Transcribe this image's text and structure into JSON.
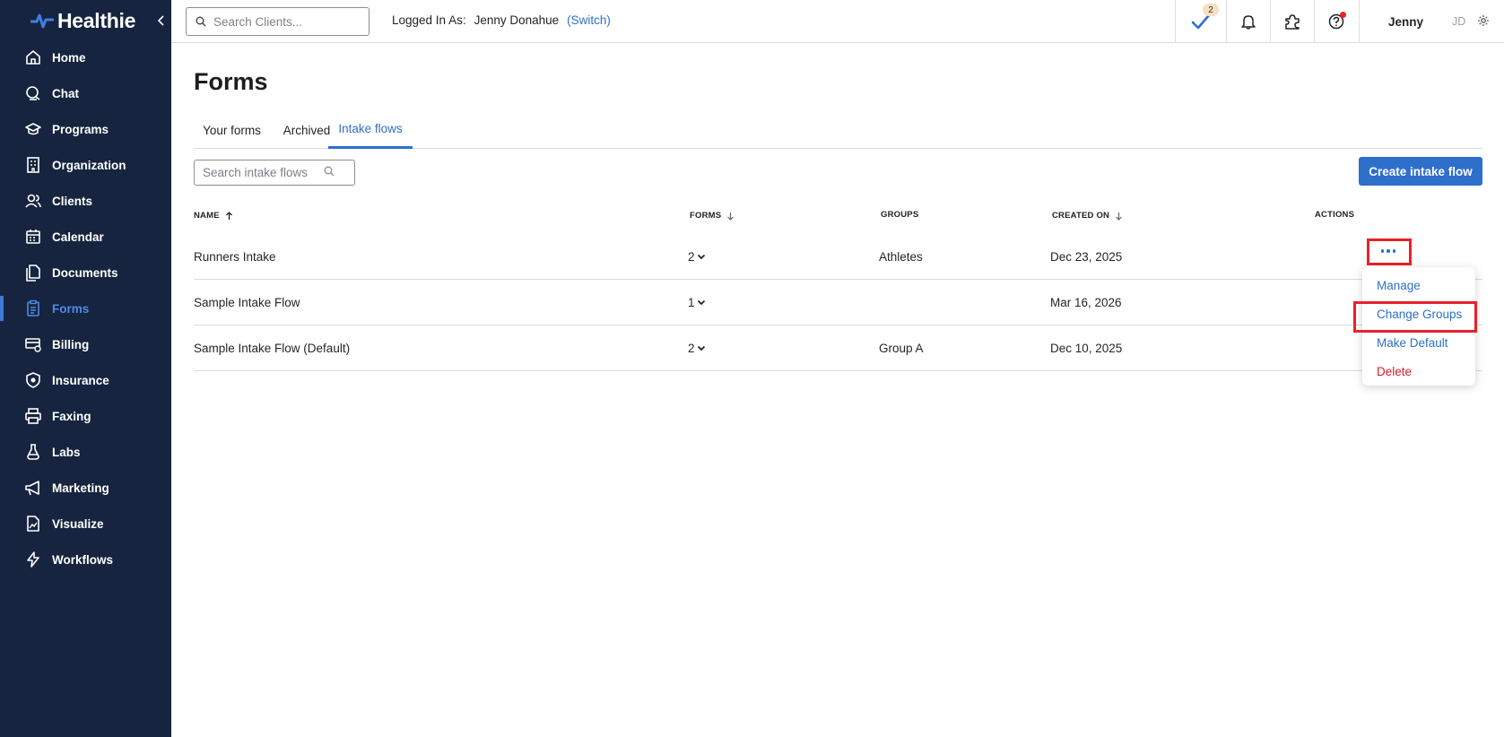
{
  "brand": {
    "name": "Healthie",
    "accent": "#2e6fcc",
    "sidebar_bg": "#16243f"
  },
  "sidebar": {
    "items": [
      {
        "label": "Home",
        "icon": "home-icon"
      },
      {
        "label": "Chat",
        "icon": "chat-icon"
      },
      {
        "label": "Programs",
        "icon": "graduation-cap-icon"
      },
      {
        "label": "Organization",
        "icon": "building-icon"
      },
      {
        "label": "Clients",
        "icon": "users-icon"
      },
      {
        "label": "Calendar",
        "icon": "calendar-icon"
      },
      {
        "label": "Documents",
        "icon": "documents-icon"
      },
      {
        "label": "Forms",
        "icon": "clipboard-icon",
        "active": true
      },
      {
        "label": "Billing",
        "icon": "billing-icon"
      },
      {
        "label": "Insurance",
        "icon": "shield-icon"
      },
      {
        "label": "Faxing",
        "icon": "printer-icon"
      },
      {
        "label": "Labs",
        "icon": "flask-icon"
      },
      {
        "label": "Marketing",
        "icon": "megaphone-icon"
      },
      {
        "label": "Visualize",
        "icon": "chart-file-icon"
      },
      {
        "label": "Workflows",
        "icon": "lightning-icon"
      }
    ]
  },
  "topbar": {
    "search_placeholder": "Search Clients...",
    "logged_in_label": "Logged In As:",
    "logged_in_user": "Jenny Donahue",
    "switch_label": "(Switch)",
    "tasks_badge": "2",
    "user_name": "Jenny",
    "user_initials": "JD"
  },
  "page": {
    "title": "Forms",
    "tabs": [
      {
        "label": "Your forms"
      },
      {
        "label": "Archived"
      },
      {
        "label": "Intake flows",
        "active": true
      }
    ],
    "filter_placeholder": "Search intake flows",
    "create_button": "Create intake flow"
  },
  "table": {
    "headers": {
      "name": "NAME",
      "forms": "FORMS",
      "groups": "GROUPS",
      "created_on": "CREATED ON",
      "actions": "ACTIONS"
    },
    "rows": [
      {
        "name": "Runners Intake",
        "forms": "2",
        "groups": "Athletes",
        "created_on": "Dec 23, 2025"
      },
      {
        "name": "Sample Intake Flow",
        "forms": "1",
        "groups": "",
        "created_on": "Mar 16, 2026"
      },
      {
        "name": "Sample Intake Flow (Default)",
        "forms": "2",
        "groups": "Group A",
        "created_on": "Dec 10, 2025"
      }
    ]
  },
  "actions_menu": {
    "items": [
      {
        "label": "Manage"
      },
      {
        "label": "Change Groups"
      },
      {
        "label": "Make Default"
      },
      {
        "label": "Delete"
      }
    ]
  }
}
